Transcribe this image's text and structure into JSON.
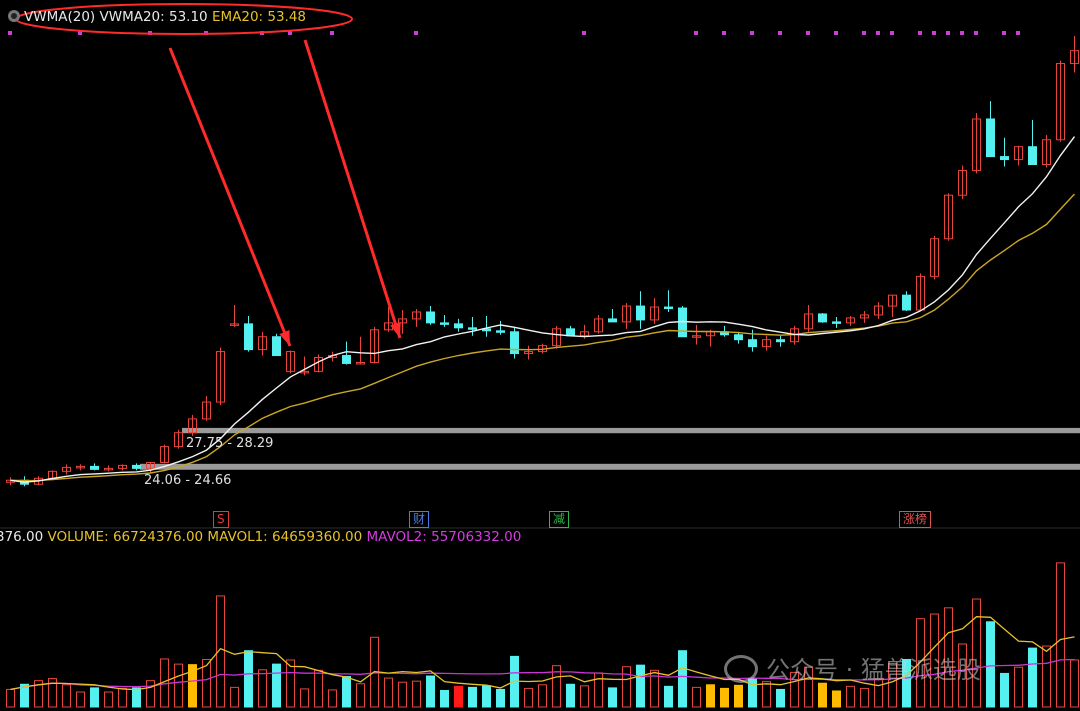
{
  "price_legend": {
    "indicator": "VWMA(20)",
    "vwma_label": "VWMA20:",
    "vwma_value": "53.10",
    "ema_label": "EMA20:",
    "ema_value": "53.48"
  },
  "volume_legend": {
    "cut_prefix": "376.00",
    "volume_label": "VOLUME:",
    "volume_value": "66724376.00",
    "mavol1_label": "MAVOL1:",
    "mavol1_value": "64659360.00",
    "mavol2_label": "MAVOL2:",
    "mavol2_value": "55706332.00"
  },
  "levels": [
    {
      "label": "27.75 - 28.29",
      "low": 27.75,
      "high": 28.29
    },
    {
      "label": "24.06 - 24.66",
      "low": 24.06,
      "high": 24.66
    }
  ],
  "event_tags": [
    {
      "text": "S",
      "index": 15,
      "color": "#e03b3b"
    },
    {
      "text": "财",
      "index": 29,
      "color": "#4a7be0"
    },
    {
      "text": "减",
      "index": 39,
      "color": "#2db84a"
    },
    {
      "text": "涨榜",
      "index": 64,
      "color": "#e05050"
    }
  ],
  "watermark": "公众号 · 猛兽派选股",
  "colors": {
    "up": "#e8453c",
    "down": "#55f0f0",
    "vwma": "#f2f2f2",
    "ema": "#c9a623",
    "mavol1": "#e6c229",
    "mavol2": "#c835d2",
    "annotation": "#ff2a2a",
    "level_band": "#9a9a9a",
    "volume_highlight": "#ffbb00"
  },
  "chart_data": {
    "type": "candlestick",
    "n_candles": 77,
    "price_axis": {
      "min": 20.5,
      "max": 69.5
    },
    "ohlc": [
      [
        22.8,
        23.3,
        22.5,
        23.0
      ],
      [
        23.0,
        23.4,
        22.4,
        22.6
      ],
      [
        22.6,
        23.4,
        22.5,
        23.2
      ],
      [
        23.2,
        24.0,
        23.0,
        23.9
      ],
      [
        23.9,
        24.6,
        23.6,
        24.3
      ],
      [
        24.3,
        24.6,
        24.0,
        24.4
      ],
      [
        24.4,
        24.7,
        24.0,
        24.1
      ],
      [
        24.1,
        24.5,
        23.9,
        24.2
      ],
      [
        24.2,
        24.6,
        24.0,
        24.5
      ],
      [
        24.5,
        24.7,
        24.0,
        24.2
      ],
      [
        24.2,
        24.8,
        23.7,
        24.8
      ],
      [
        24.8,
        26.6,
        24.7,
        26.4
      ],
      [
        26.4,
        28.1,
        26.2,
        27.8
      ],
      [
        27.8,
        29.6,
        27.5,
        29.2
      ],
      [
        29.2,
        31.5,
        29.0,
        30.9
      ],
      [
        30.9,
        36.4,
        30.6,
        36.0
      ],
      [
        38.8,
        40.7,
        38.5,
        38.8
      ],
      [
        38.8,
        39.6,
        36.0,
        36.2
      ],
      [
        36.2,
        38.0,
        35.6,
        37.5
      ],
      [
        37.5,
        37.8,
        35.6,
        35.6
      ],
      [
        34.0,
        36.1,
        33.8,
        36.0
      ],
      [
        34.0,
        35.5,
        33.6,
        34.0
      ],
      [
        34.0,
        35.7,
        33.9,
        35.4
      ],
      [
        35.4,
        36.0,
        35.0,
        35.6
      ],
      [
        35.6,
        37.0,
        34.7,
        34.8
      ],
      [
        34.8,
        37.5,
        34.7,
        34.9
      ],
      [
        34.9,
        38.5,
        34.8,
        38.2
      ],
      [
        38.2,
        40.5,
        38.0,
        38.9
      ],
      [
        38.9,
        40.2,
        37.8,
        39.3
      ],
      [
        39.3,
        40.3,
        38.5,
        40.0
      ],
      [
        40.0,
        40.6,
        38.7,
        38.9
      ],
      [
        38.9,
        39.7,
        38.5,
        38.8
      ],
      [
        38.8,
        39.3,
        38.0,
        38.4
      ],
      [
        38.4,
        39.5,
        37.6,
        38.3
      ],
      [
        38.3,
        39.6,
        37.5,
        38.1
      ],
      [
        38.1,
        39.1,
        37.7,
        38.0
      ],
      [
        38.0,
        38.5,
        35.3,
        35.8
      ],
      [
        35.8,
        36.6,
        35.2,
        36.0
      ],
      [
        36.0,
        36.8,
        35.8,
        36.6
      ],
      [
        36.6,
        38.6,
        36.3,
        38.3
      ],
      [
        38.3,
        38.6,
        37.6,
        37.6
      ],
      [
        37.6,
        38.7,
        37.3,
        38.0
      ],
      [
        38.0,
        39.7,
        37.8,
        39.3
      ],
      [
        39.3,
        40.3,
        39.0,
        39.0
      ],
      [
        39.0,
        40.9,
        38.3,
        40.6
      ],
      [
        40.6,
        42.1,
        38.3,
        39.2
      ],
      [
        39.2,
        41.4,
        38.8,
        40.5
      ],
      [
        40.5,
        42.2,
        40.0,
        40.4
      ],
      [
        40.4,
        40.6,
        37.5,
        37.5
      ],
      [
        37.5,
        38.7,
        36.7,
        37.6
      ],
      [
        37.6,
        38.2,
        36.5,
        38.0
      ],
      [
        38.0,
        38.6,
        37.5,
        37.7
      ],
      [
        37.7,
        38.0,
        36.8,
        37.2
      ],
      [
        37.2,
        38.2,
        36.0,
        36.5
      ],
      [
        36.5,
        37.6,
        36.1,
        37.2
      ],
      [
        37.2,
        37.6,
        36.5,
        37.0
      ],
      [
        37.0,
        38.6,
        36.7,
        38.3
      ],
      [
        38.3,
        40.7,
        38.0,
        39.8
      ],
      [
        39.8,
        39.9,
        38.9,
        39.0
      ],
      [
        39.0,
        39.5,
        38.4,
        38.9
      ],
      [
        38.9,
        39.6,
        38.6,
        39.4
      ],
      [
        39.4,
        40.1,
        38.9,
        39.7
      ],
      [
        39.7,
        41.0,
        39.3,
        40.6
      ],
      [
        40.6,
        41.7,
        39.5,
        41.7
      ],
      [
        41.7,
        42.1,
        40.1,
        40.2
      ],
      [
        40.2,
        43.9,
        40.1,
        43.6
      ],
      [
        43.6,
        47.7,
        43.3,
        47.4
      ],
      [
        47.4,
        52.0,
        47.2,
        51.8
      ],
      [
        51.8,
        54.8,
        51.4,
        54.3
      ],
      [
        54.3,
        60.1,
        54.0,
        59.5
      ],
      [
        59.5,
        61.3,
        55.7,
        55.7
      ],
      [
        55.7,
        57.6,
        54.7,
        55.4
      ],
      [
        55.4,
        56.8,
        54.8,
        56.7
      ],
      [
        56.7,
        59.4,
        54.9,
        54.9
      ],
      [
        54.9,
        57.9,
        54.6,
        57.4
      ],
      [
        57.4,
        65.4,
        57.2,
        65.1
      ],
      [
        65.1,
        67.9,
        64.2,
        66.4
      ]
    ],
    "vwma": [],
    "ema": [],
    "volume": [],
    "mavol1": [],
    "mavol2": []
  }
}
